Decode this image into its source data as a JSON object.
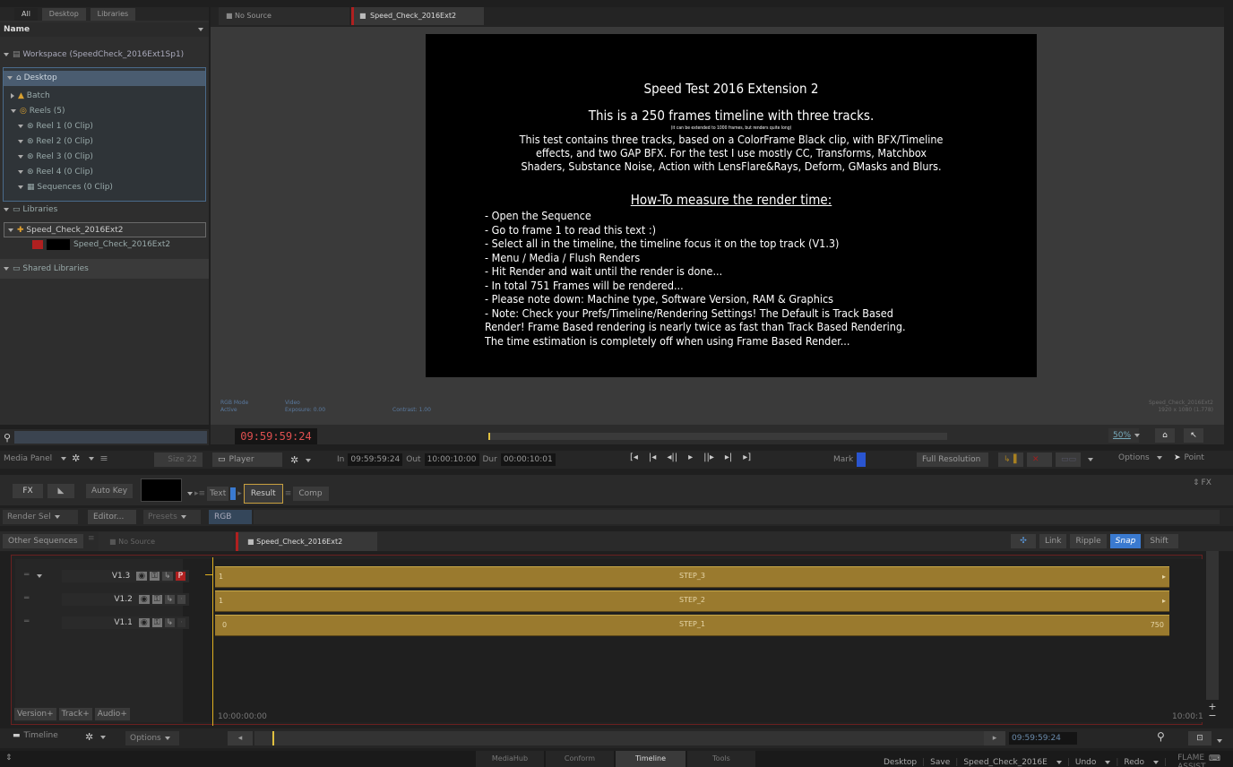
{
  "browser": {
    "tabs": [
      "All",
      "Desktop",
      "Libraries"
    ],
    "column_header": "Name",
    "workspace": "Workspace (SpeedCheck_2016Ext1Sp1)",
    "desktop": "Desktop",
    "batch": "Batch",
    "reels": "Reels (5)",
    "reel_items": [
      "Reel 1 (0 Clip)",
      "Reel 2 (0 Clip)",
      "Reel 3 (0 Clip)",
      "Reel 4 (0 Clip)"
    ],
    "sequences": "Sequences (0 Clip)",
    "libraries": "Libraries",
    "library_item": "Speed_Check_2016Ext2",
    "clip": "Speed_Check_2016Ext2",
    "shared": "Shared Libraries"
  },
  "viewer": {
    "tabs": [
      "No Source",
      "Speed_Check_2016Ext2"
    ],
    "slate": {
      "title": "Speed Test 2016 Extension 2",
      "headline": "This is a 250 frames timeline with three tracks.",
      "small": "(it can be extended to 1000 frames, but renders quite long)",
      "body": [
        "This test contains three tracks, based on a ColorFrame Black clip, with BFX/Timeline",
        "effects, and two GAP BFX. For the test I use mostly CC, Transforms, Matchbox",
        "Shaders, Substance Noise, Action with LensFlare&Rays, Deform, GMasks and Blurs."
      ],
      "howto": "How-To measure the render time:",
      "steps": [
        "- Open the Sequence",
        "- Go to frame 1 to read this text :)",
        "- Select all in the timeline, the timeline focus it on the top track (V1.3)",
        "- Menu / Media / Flush Renders",
        "- Hit Render and wait until the render is done...",
        "- In total 751 Frames will be rendered...",
        "- Please note down: Machine type, Software Version, RAM & Graphics",
        "- Note: Check your Prefs/Timeline/Rendering Settings! The Default is Track Based",
        "Render! Frame Based rendering is nearly twice as fast than Track Based Rendering.",
        "The time estimation is completely off when using Frame Based Render..."
      ]
    },
    "overlay": {
      "rgb_mode": "RGB Mode",
      "active": "Active",
      "video": "Video",
      "exposure": "Exposure: 0.00",
      "contrast": "Contrast: 1.00",
      "clip_name": "Speed_Check_2016Ext2",
      "resolution": "1920 x 1080 (1.778)"
    },
    "timecode": "09:59:59:24",
    "zoom": "50%"
  },
  "transport": {
    "media_panel": "Media Panel",
    "size": "Size 22",
    "player": "Player",
    "in_label": "In",
    "in": "09:59:59:24",
    "out_label": "Out",
    "out": "10:00:10:00",
    "dur_label": "Dur",
    "dur": "00:00:10:01",
    "mark": "Mark",
    "full_res": "Full Resolution",
    "options": "Options",
    "point": "Point"
  },
  "fx": {
    "fx": "FX",
    "auto_key": "Auto Key",
    "text": "Text",
    "result": "Result",
    "comp": "Comp",
    "render_sel": "Render Sel",
    "editor": "Editor...",
    "presets": "Presets",
    "rgb": "RGB",
    "fx_right": "FX"
  },
  "timeline": {
    "other_sequences": "Other Sequences",
    "tabs": [
      "No Source",
      "Speed_Check_2016Ext2"
    ],
    "tools": [
      "Link",
      "Ripple",
      "Snap",
      "Shift"
    ],
    "tracks": [
      {
        "name": "V1.3",
        "clip": "STEP_3",
        "start": "1",
        "end": ""
      },
      {
        "name": "V1.2",
        "clip": "STEP_2",
        "start": "1",
        "end": ""
      },
      {
        "name": "V1.1",
        "clip": "STEP_1",
        "start": "0",
        "end": "750"
      }
    ],
    "start_tc": "10:00:00:00",
    "end_tc": "10:00:1",
    "version": "Version+",
    "track": "Track+",
    "audio": "Audio+",
    "footer_label": "Timeline",
    "options": "Options",
    "current_tc": "09:59:59:24"
  },
  "bottom": {
    "tabs": [
      "MediaHub",
      "Conform",
      "Timeline",
      "Tools"
    ],
    "active_tab": "Timeline",
    "right": [
      "Desktop",
      "Save",
      "Speed_Check_2016E",
      "Undo",
      "Redo",
      "FLAME ASSIST"
    ]
  }
}
